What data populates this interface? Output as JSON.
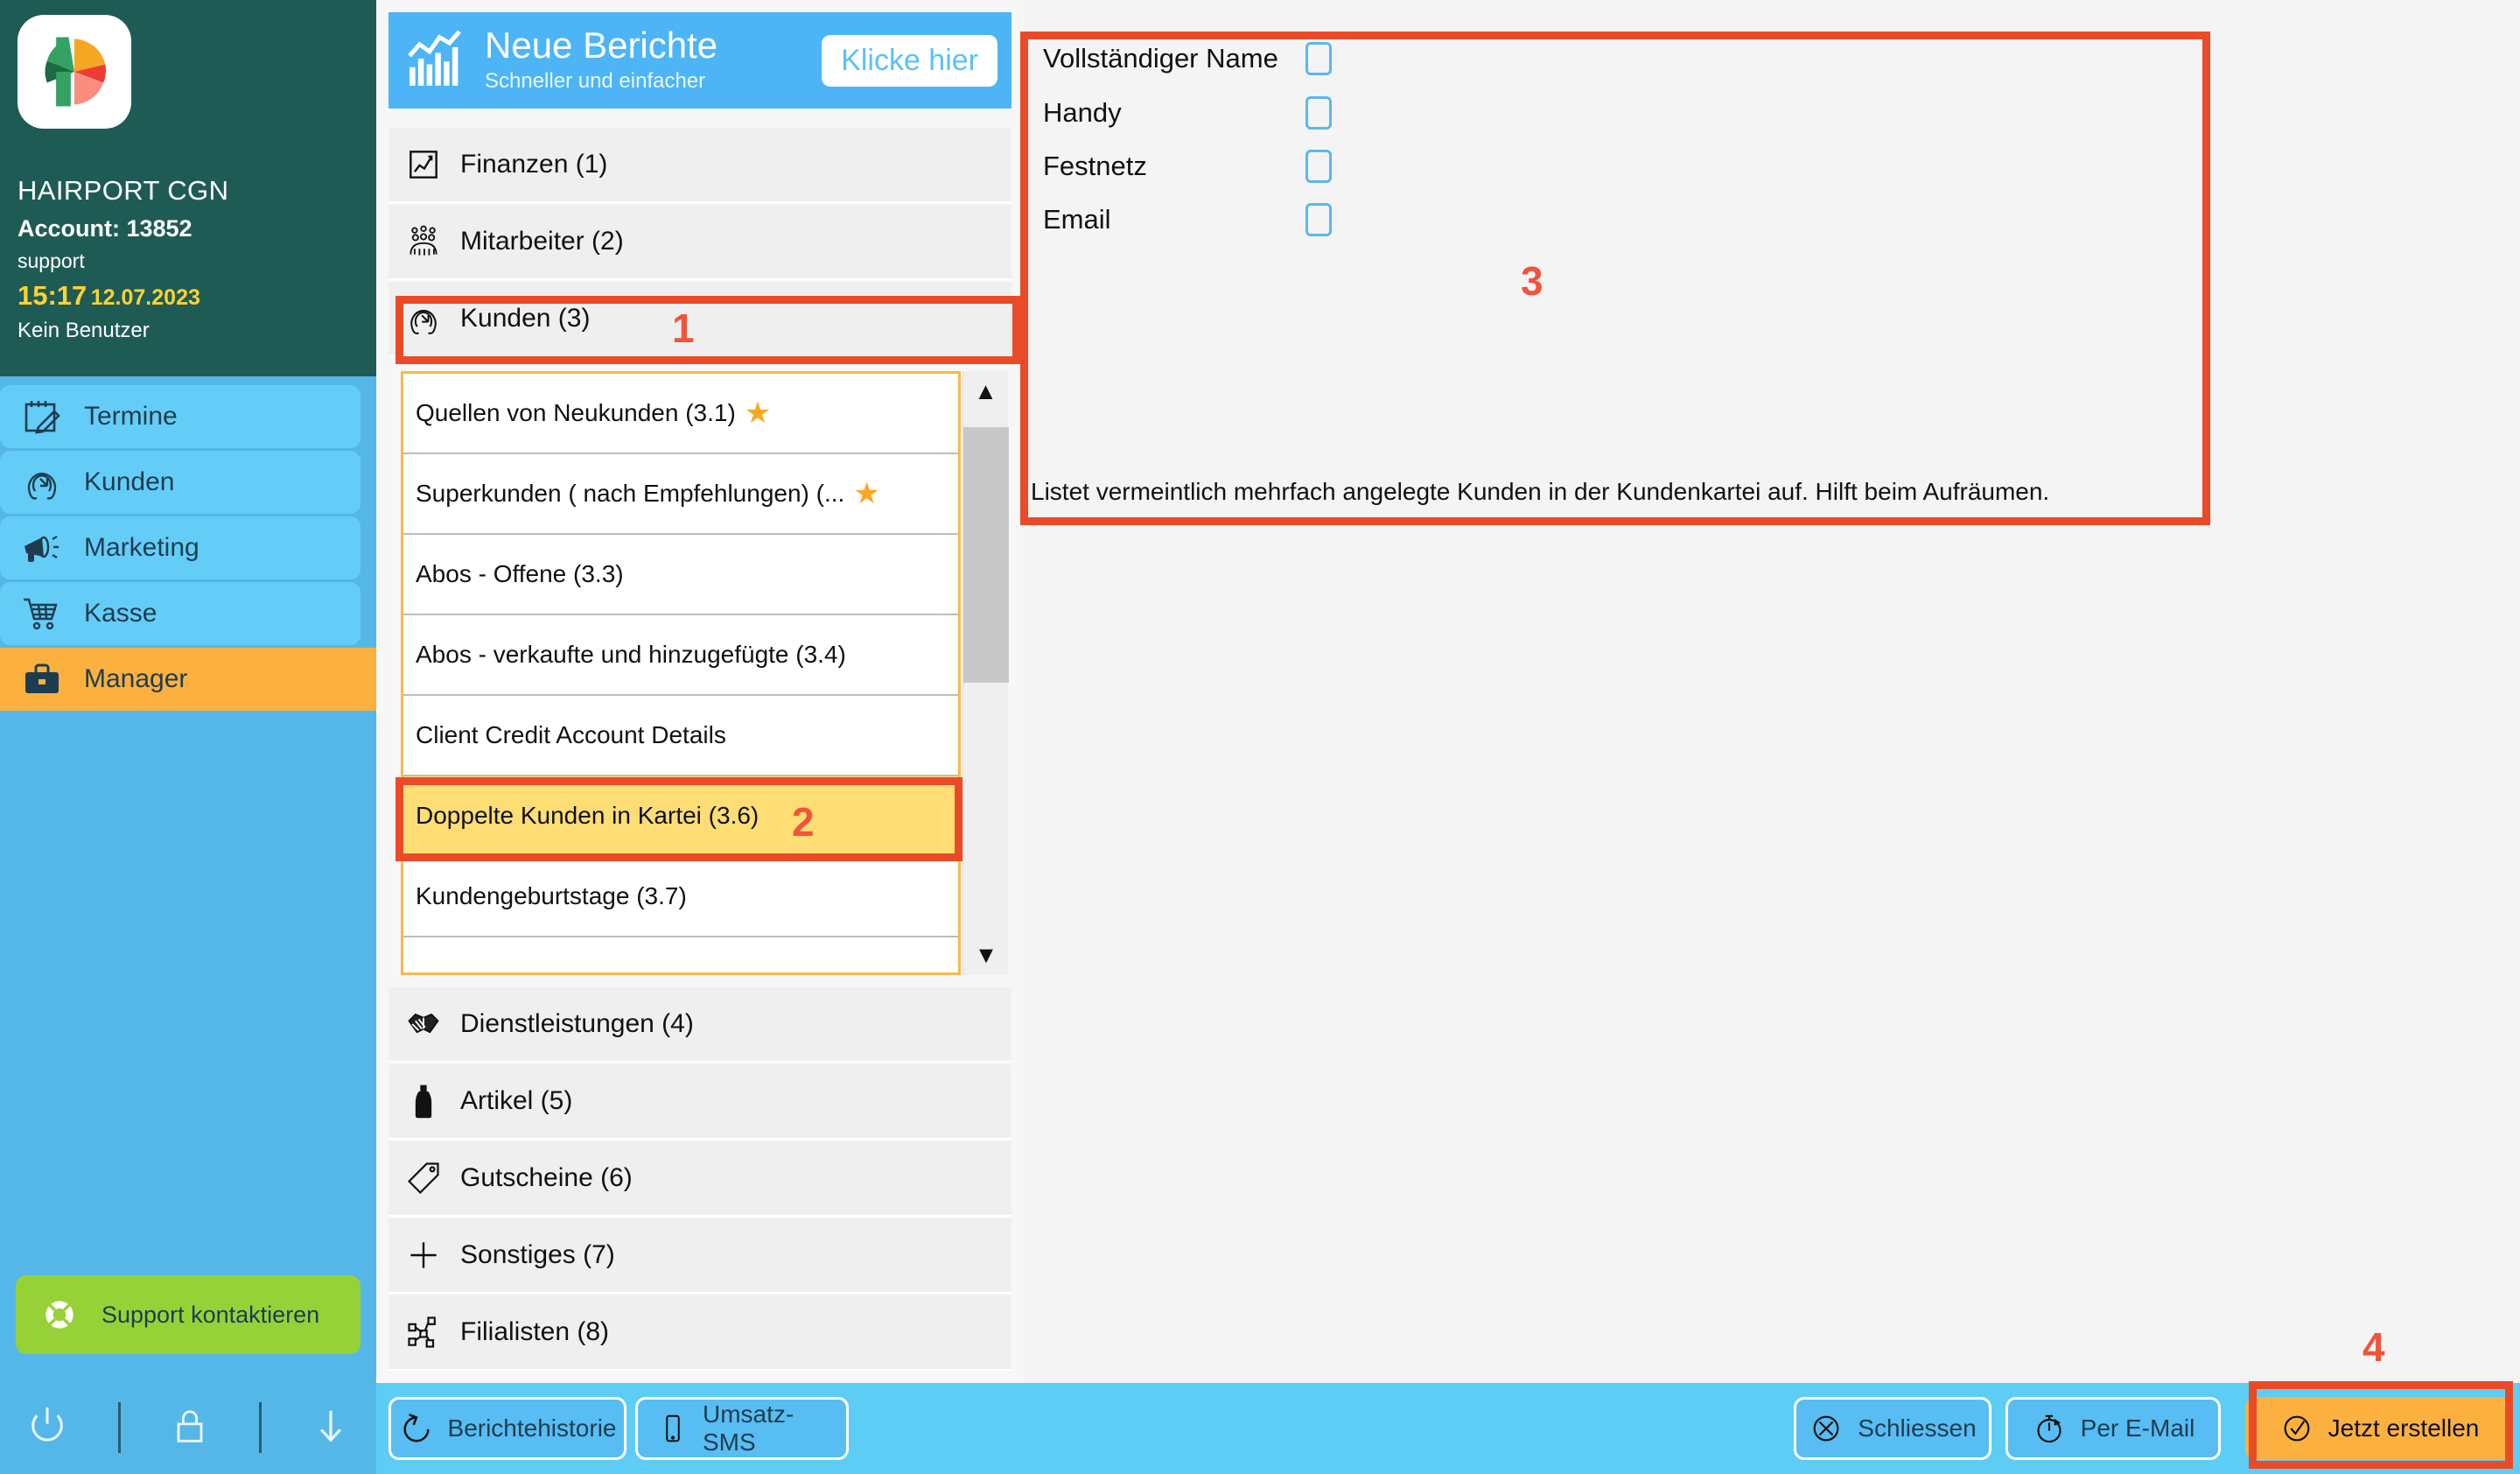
{
  "sidebar": {
    "logo_icon": "phorest-logo-icon",
    "org_name": "HAIRPORT CGN",
    "account_label": "Account: 13852",
    "user_name": "support",
    "clock_time": "15:17",
    "clock_date": "12.07.2023",
    "no_user": "Kein Benutzer",
    "nav": [
      {
        "label": "Termine",
        "icon": "calendar-edit-icon",
        "active": false
      },
      {
        "label": "Kunden",
        "icon": "client-head-icon",
        "active": false
      },
      {
        "label": "Marketing",
        "icon": "megaphone-icon",
        "active": false
      },
      {
        "label": "Kasse",
        "icon": "shopping-cart-icon",
        "active": false
      },
      {
        "label": "Manager",
        "icon": "briefcase-icon",
        "active": true
      }
    ],
    "support_button": {
      "label": "Support kontaktieren",
      "icon": "lifebuoy-icon"
    },
    "footer_icons": [
      {
        "name": "power-icon"
      },
      {
        "name": "lock-icon"
      },
      {
        "name": "download-arrow-icon"
      }
    ]
  },
  "promo": {
    "icon": "bar-chart-icon",
    "title": "Neue Berichte",
    "subtitle": "Schneller und einfacher",
    "cta_label": "Klicke hier"
  },
  "categories_top": [
    {
      "label": "Finanzen (1)",
      "icon": "line-chart-icon",
      "selected": false
    },
    {
      "label": "Mitarbeiter (2)",
      "icon": "staff-group-icon",
      "selected": false
    },
    {
      "label": "Kunden (3)",
      "icon": "client-head-icon",
      "selected": true
    }
  ],
  "categories_bottom": [
    {
      "label": "Dienstleistungen (4)",
      "icon": "handshake-icon"
    },
    {
      "label": "Artikel (5)",
      "icon": "bottle-icon"
    },
    {
      "label": "Gutscheine (6)",
      "icon": "tag-icon"
    },
    {
      "label": "Sonstiges (7)",
      "icon": "plus-icon"
    },
    {
      "label": "Filialisten (8)",
      "icon": "network-nodes-icon"
    }
  ],
  "sub_reports": [
    {
      "label": "Quellen von Neukunden (3.1)",
      "starred": true,
      "selected": false
    },
    {
      "label": "Superkunden ( nach Empfehlungen) (...",
      "starred": true,
      "selected": false
    },
    {
      "label": "Abos - Offene (3.3)",
      "starred": false,
      "selected": false
    },
    {
      "label": "Abos - verkaufte und hinzugefügte  (3.4)",
      "starred": false,
      "selected": false
    },
    {
      "label": "Client Credit Account Details",
      "starred": false,
      "selected": false
    },
    {
      "label": "Doppelte Kunden in Kartei (3.6)",
      "starred": false,
      "selected": true
    },
    {
      "label": "Kundengeburtstage (3.7)",
      "starred": false,
      "selected": false
    },
    {
      "label": "",
      "starred": false,
      "selected": false
    }
  ],
  "scrollbar": {
    "up_glyph": "▲",
    "down_glyph": "▼",
    "name": "sub-report-scrollbar"
  },
  "main": {
    "options": [
      {
        "label": "Vollständiger Name",
        "checked": false
      },
      {
        "label": "Handy",
        "checked": false
      },
      {
        "label": "Festnetz",
        "checked": false
      },
      {
        "label": "Email",
        "checked": false
      }
    ],
    "description": "Listet vermeintlich mehrfach angelegte Kunden in der Kundenkartei auf. Hilft beim Aufräumen."
  },
  "toolbar": {
    "left_buttons": [
      {
        "label": "Berichtehistorie",
        "icon": "history-undo-icon"
      },
      {
        "label": "Umsatz-SMS",
        "icon": "mobile-phone-icon"
      }
    ],
    "right_buttons": [
      {
        "label": "Schliessen",
        "icon": "close-circle-icon",
        "accent": false
      },
      {
        "label": "Per E-Mail",
        "icon": "stopwatch-icon",
        "accent": false
      },
      {
        "label": "Jetzt erstellen",
        "icon": "check-circle-icon",
        "accent": true
      }
    ]
  },
  "annotations": [
    {
      "number": "1"
    },
    {
      "number": "2"
    },
    {
      "number": "3"
    },
    {
      "number": "4"
    }
  ],
  "colors": {
    "sidebar_blue": "#55b7e8",
    "sidebar_dark": "#1f5b55",
    "accent_orange": "#fbb040",
    "annotation_red": "#ea4a28",
    "promo_blue": "#4db5f5",
    "support_green": "#96d237",
    "clock_yellow": "#ffd233"
  }
}
